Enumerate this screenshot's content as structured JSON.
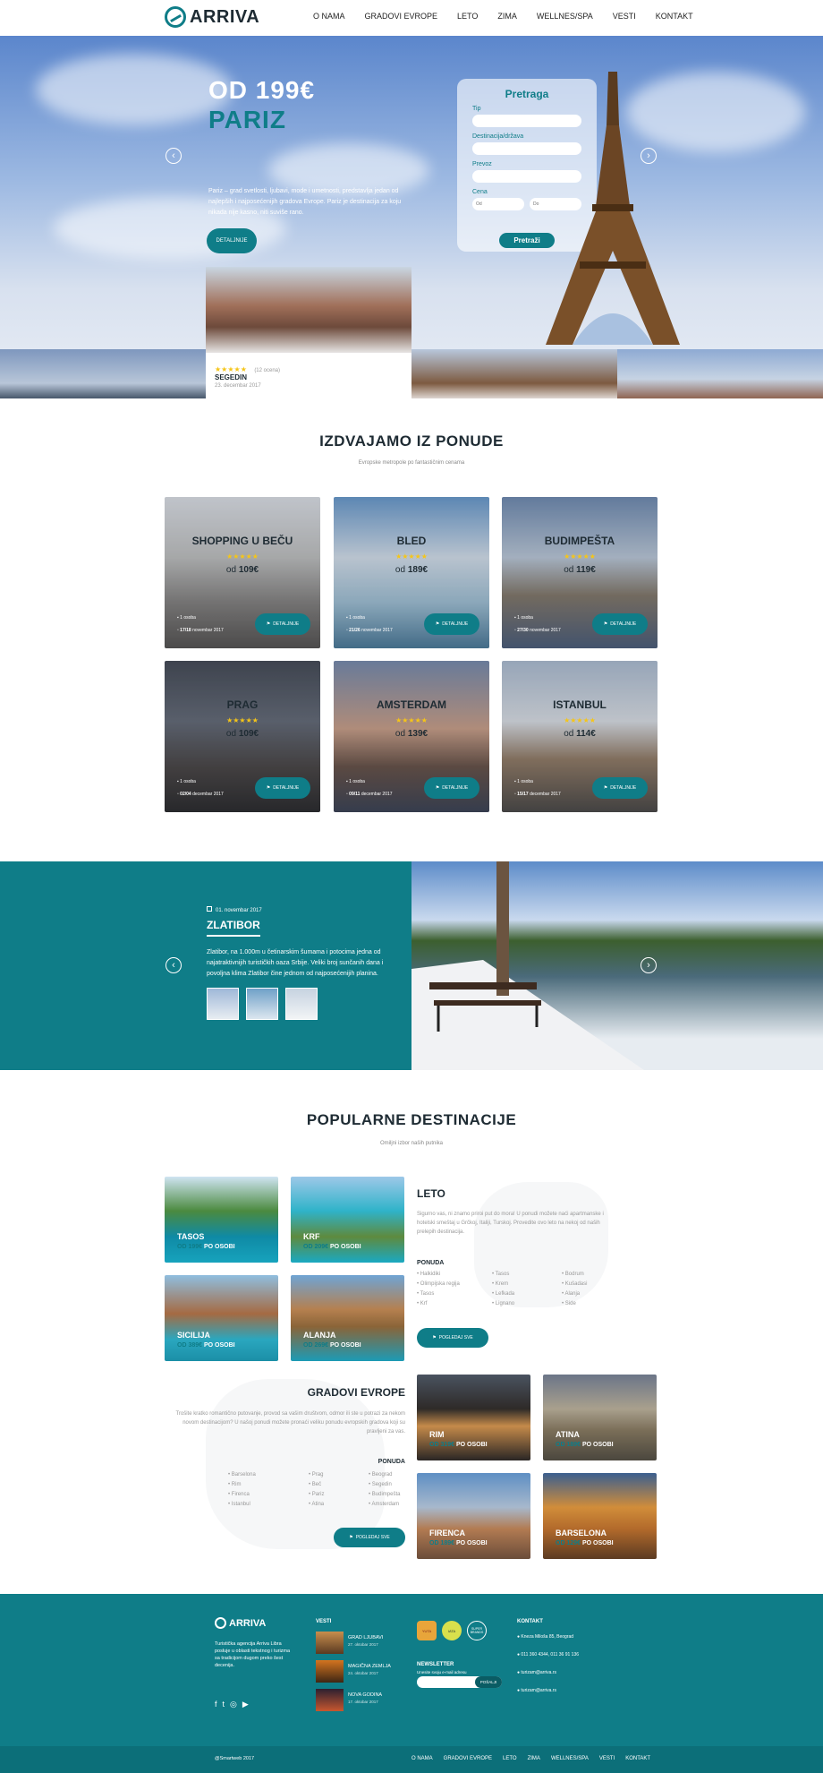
{
  "header": {
    "logo": "ARRIVA",
    "nav": [
      "O NAMA",
      "GRADOVI EVROPE",
      "LETO",
      "ZIMA",
      "WELLNES/SPA",
      "VESTI",
      "KONTAKT"
    ]
  },
  "hero": {
    "price": "OD 199€",
    "city": "PARIZ",
    "description": "Pariz – grad svetlosti, ljubavi, mode i umetnosti, predstavlja jedan od najlepših i najposećenijih gradova Evrope. Pariz je destinacija za koju nikada nije kasno, niti suviše rano.",
    "button": "DETALJNIJE",
    "search": {
      "title": "Pretraga",
      "labels": [
        "Tip",
        "Destinacija/država",
        "Prevoz",
        "Cena"
      ],
      "price_from_placeholder": "Od",
      "price_to_placeholder": "Do",
      "button": "Pretraži"
    },
    "featured": {
      "rating_text": "(12 ocena)",
      "city": "SEGEDIN",
      "date": "23. decembar 2017"
    }
  },
  "offers": {
    "title": "IZDVAJAMO IZ PONUDE",
    "subtitle": "Evropske metropole po fantastičnim cenama",
    "price_prefix": "od",
    "details_label": "DETALJNIJE",
    "persons": "1 osoba",
    "cards": [
      {
        "name": "SHOPPING U BEČU",
        "price": "109€",
        "date_bold": "17/18",
        "date_rest": "novembar 2017"
      },
      {
        "name": "BLED",
        "price": "189€",
        "date_bold": "21/26",
        "date_rest": "novembar 2017"
      },
      {
        "name": "BUDIMPEŠTA",
        "price": "119€",
        "date_bold": "27/30",
        "date_rest": "novembar 2017"
      },
      {
        "name": "PRAG",
        "price": "109€",
        "date_bold": "02/04",
        "date_rest": "decembar 2017"
      },
      {
        "name": "AMSTERDAM",
        "price": "139€",
        "date_bold": "09/11",
        "date_rest": "decembar 2017"
      },
      {
        "name": "ISTANBUL",
        "price": "114€",
        "date_bold": "15/17",
        "date_rest": "decembar 2017"
      }
    ]
  },
  "zlatibor": {
    "date": "01. novembar 2017",
    "title": "ZLATIBOR",
    "text": "Zlatibor, na 1.000m u četinarskim šumama i potocima jedna od najatraktivnijih turističkih oaza Srbije. Veliki broj sunčanih dana i povoljna klima Zlatibor čine jednom od najposećenijih planina."
  },
  "popular": {
    "title": "POPULARNE DESTINACIJE",
    "subtitle": "Omiljni izbor naših putnika",
    "per_person": "PO OSOBI",
    "summer": {
      "title": "LETO",
      "text": "Sigurno vas, ni znamo priroi put do mora! U ponudi možete naći apartmanske i hotelski smeštaj u Grčkoj, Italiji, Turskoj. Provedite ovo leto na nekoj od naših prelepih destinacija.",
      "offer_label": "PONUDA",
      "list": [
        [
          "Halkidiki",
          "Olimpijska regija",
          "Tasos",
          "Krf"
        ],
        [
          "Tasos",
          "Krem",
          "Lefkada",
          "Lignano"
        ],
        [
          "Bodrum",
          "Kušadasi",
          "Alanja",
          "Side"
        ]
      ],
      "button": "POGLEDAJ SVE",
      "cards": [
        {
          "name": "TASOS",
          "price": "OD 199€"
        },
        {
          "name": "KRF",
          "price": "OD 209€"
        },
        {
          "name": "SICILIJA",
          "price": "OD 389€"
        },
        {
          "name": "ALANJA",
          "price": "OD 269€"
        }
      ]
    },
    "europe": {
      "title": "GRADOVI EVROPE",
      "text": "Trošite kratko romantično putovanje, provod sa vašim društvom, odmor ili ste u potrazi za nekom novom destinacijom? U našoj ponudi možete pronaći veliku ponudu evropskih gradova koji su pravljeni za vas.",
      "offer_label": "PONUDA",
      "list": [
        [
          "Barselona",
          "Rim",
          "Firenca",
          "Istanbul"
        ],
        [
          "Prag",
          "Beč",
          "Pariz",
          "Atina"
        ],
        [
          "Beograd",
          "Segedin",
          "Budimpešta",
          "Amsterdam"
        ]
      ],
      "button": "POGLEDAJ SVE",
      "cards": [
        {
          "name": "RIM",
          "price": "OD 319€"
        },
        {
          "name": "ATINA",
          "price": "OD 189€"
        },
        {
          "name": "FIRENCA",
          "price": "OD 189€"
        },
        {
          "name": "BARSELONA",
          "price": "OD 129€"
        }
      ]
    }
  },
  "footer": {
    "logo": "ARRIVA",
    "about": "Turistička agencija Arriva Libra posluje u oblasti tekstnog i turizma sa tradicijom dugom preko šest decenija.",
    "news_title": "VESTI",
    "news": [
      {
        "title": "GRAD LJUBAVI",
        "date": "27. oktobar 2017"
      },
      {
        "title": "MAGIČNA ZEMLJA",
        "date": "24. oktobar 2017"
      },
      {
        "title": "NOVA GODINA",
        "date": "17. oktobar 2017"
      }
    ],
    "badges": [
      "YUTA",
      "IATA",
      "SUPER BRANDS"
    ],
    "newsletter_title": "NEWSLETTER",
    "newsletter_placeholder": "Unesite svoju e-mail adresu",
    "newsletter_button": "POŠALJI",
    "contact_title": "KONTAKT",
    "contact": [
      "Kneza Miloša 85, Beograd",
      "011 360 4344, 011 36 91 136",
      "turizam@arriva.rs",
      "turizam@arriva.rs"
    ],
    "copyright": "@Smartweb 2017",
    "nav": [
      "O NAMA",
      "GRADOVI EVROPE",
      "LETO",
      "ZIMA",
      "WELLNES/SPA",
      "VESTI",
      "KONTAKT"
    ]
  }
}
